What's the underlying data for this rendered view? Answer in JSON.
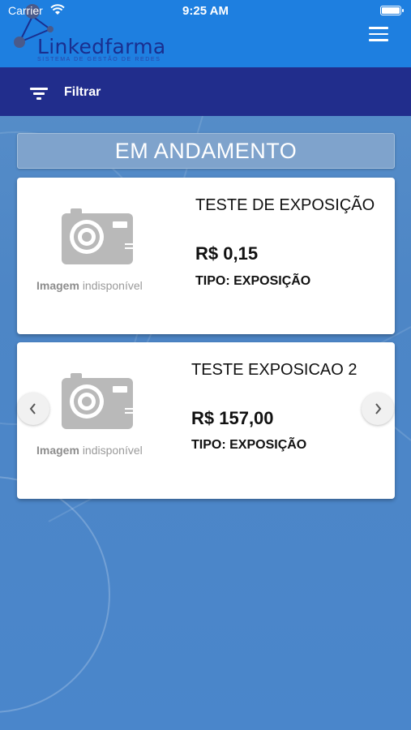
{
  "status_bar": {
    "carrier": "Carrier",
    "time": "9:25 AM"
  },
  "header": {
    "brand": "Linkedfarma",
    "subtitle": "Sistema de Gestão de Redes"
  },
  "filter": {
    "label": "Filtrar"
  },
  "section": {
    "title": "EM ANDAMENTO"
  },
  "cards": [
    {
      "title": "TESTE DE EXPOSIÇÃO",
      "price": "R$ 0,15",
      "type": "TIPO: EXPOSIÇÃO",
      "image_label_bold": "Imagem",
      "image_label_rest": "indisponível"
    },
    {
      "title": "TESTE EXPOSICAO 2",
      "price": "R$ 157,00",
      "type": "TIPO: EXPOSIÇÃO",
      "image_label_bold": "Imagem",
      "image_label_rest": "indisponível"
    }
  ],
  "colors": {
    "header_bg": "#1e7fe0",
    "filter_bg": "#212d8c",
    "brand_text": "#1a2f8f"
  },
  "icons": [
    "wifi-icon",
    "battery-icon",
    "hamburger-menu-icon",
    "filter-icon",
    "camera-placeholder-icon",
    "chevron-left-icon",
    "chevron-right-icon"
  ]
}
